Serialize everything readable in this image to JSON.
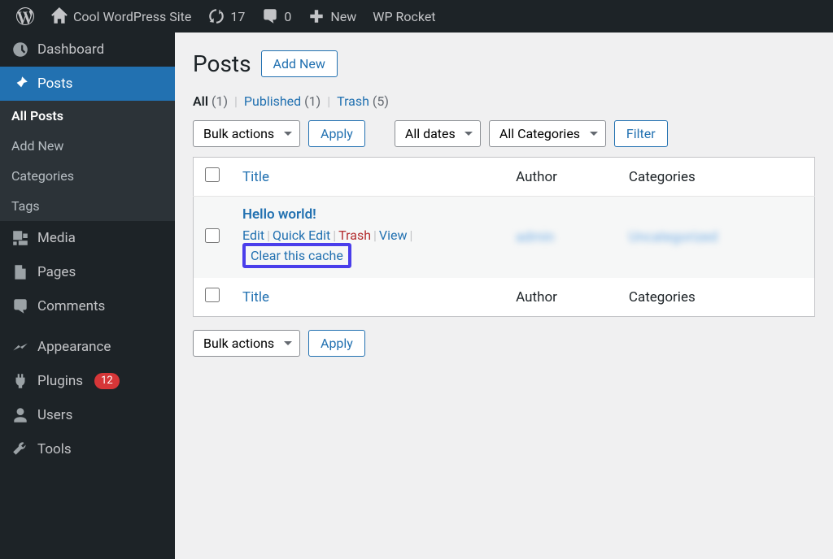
{
  "adminbar": {
    "site_name": "Cool WordPress Site",
    "updates": "17",
    "comments": "0",
    "new": "New",
    "wp_rocket": "WP Rocket"
  },
  "sidebar": {
    "dashboard": "Dashboard",
    "posts": "Posts",
    "sub_all_posts": "All Posts",
    "sub_add_new": "Add New",
    "sub_categories": "Categories",
    "sub_tags": "Tags",
    "media": "Media",
    "pages": "Pages",
    "comments": "Comments",
    "appearance": "Appearance",
    "plugins": "Plugins",
    "plugins_badge": "12",
    "users": "Users",
    "tools": "Tools"
  },
  "main": {
    "heading": "Posts",
    "add_new": "Add New",
    "filters": {
      "all": "All",
      "all_count": "(1)",
      "published": "Published",
      "published_count": "(1)",
      "trash": "Trash",
      "trash_count": "(5)"
    },
    "bulk_actions": "Bulk actions",
    "apply": "Apply",
    "all_dates": "All dates",
    "all_categories": "All Categories",
    "filter": "Filter",
    "columns": {
      "title": "Title",
      "author": "Author",
      "categories": "Categories"
    },
    "row": {
      "title": "Hello world!",
      "author_blur": "admin",
      "categories_blur": "Uncategorized",
      "actions": {
        "edit": "Edit",
        "quick_edit": "Quick Edit",
        "trash": "Trash",
        "view": "View",
        "clear_cache": "Clear this cache"
      }
    }
  }
}
